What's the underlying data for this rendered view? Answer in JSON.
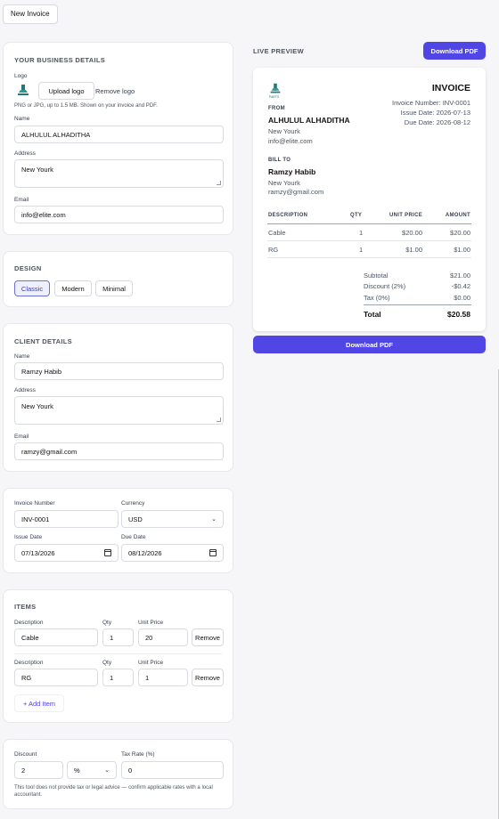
{
  "toolbar": {
    "new_invoice": "New Invoice"
  },
  "business": {
    "title": "YOUR BUSINESS DETAILS",
    "logo_label": "Logo",
    "upload_logo": "Upload logo",
    "remove_logo": "Remove logo",
    "logo_hint": "PNG or JPG, up to 1.5 MB. Shown on your invoice and PDF.",
    "name_label": "Name",
    "name_value": "ALHULUL ALHADITHA",
    "address_label": "Address",
    "address_value": "New Yourk",
    "email_label": "Email",
    "email_value": "info@elite.com"
  },
  "design": {
    "title": "DESIGN",
    "options": [
      "Classic",
      "Modern",
      "Minimal"
    ],
    "selected": "Classic"
  },
  "client": {
    "title": "CLIENT DETAILS",
    "name_label": "Name",
    "name_value": "Ramzy Habib",
    "address_label": "Address",
    "address_value": "New Yourk",
    "email_label": "Email",
    "email_value": "ramzy@gmail.com"
  },
  "meta": {
    "invoice_number_label": "Invoice Number",
    "invoice_number_value": "INV-0001",
    "currency_label": "Currency",
    "currency_value": "USD",
    "issue_date_label": "Issue Date",
    "issue_date_value": "07/13/2026",
    "due_date_label": "Due Date",
    "due_date_value": "08/12/2026"
  },
  "items": {
    "title": "ITEMS",
    "description_label": "Description",
    "qty_label": "Qty",
    "unit_price_label": "Unit Price",
    "remove_label": "Remove",
    "rows": [
      {
        "description": "Cable",
        "qty": "1",
        "unit_price": "20"
      },
      {
        "description": "RG",
        "qty": "1",
        "unit_price": "1"
      }
    ],
    "add_item": "+ Add Item"
  },
  "adjustments": {
    "discount_label": "Discount",
    "discount_value": "2",
    "discount_type": "%",
    "tax_label": "Tax Rate (%)",
    "tax_value": "0",
    "disclaimer": "This tool does not provide tax or legal advice — confirm applicable rates with a local accountant."
  },
  "preview": {
    "label": "LIVE PREVIEW",
    "download_pdf": "Download PDF",
    "invoice_title": "INVOICE",
    "invoice_number_line": "Invoice Number: INV-0001",
    "issue_date_line": "Issue Date: 2026-07-13",
    "due_date_line": "Due Date: 2026-08-12",
    "from_label": "FROM",
    "from_name": "ALHULUL ALHADITHA",
    "from_address": "New Yourk",
    "from_email": "info@elite.com",
    "bill_to_label": "BILL TO",
    "bill_name": "Ramzy Habib",
    "bill_address": "New Yourk",
    "bill_email": "ramzy@gmail.com",
    "col_description": "DESCRIPTION",
    "col_qty": "QTY",
    "col_unit_price": "UNIT PRICE",
    "col_amount": "AMOUNT",
    "rows": [
      {
        "description": "Cable",
        "qty": "1",
        "unit_price": "$20.00",
        "amount": "$20.00"
      },
      {
        "description": "RG",
        "qty": "1",
        "unit_price": "$1.00",
        "amount": "$1.00"
      }
    ],
    "subtotal_label": "Subtotal",
    "subtotal_value": "$21.00",
    "discount_label": "Discount (2%)",
    "discount_value": "-$0.42",
    "tax_label": "Tax (0%)",
    "tax_value": "$0.00",
    "total_label": "Total",
    "total_value": "$20.58",
    "logo_caption": "PARTS"
  },
  "colors": {
    "primary": "#4f46e5",
    "selected_border": "#6b6fd8"
  }
}
